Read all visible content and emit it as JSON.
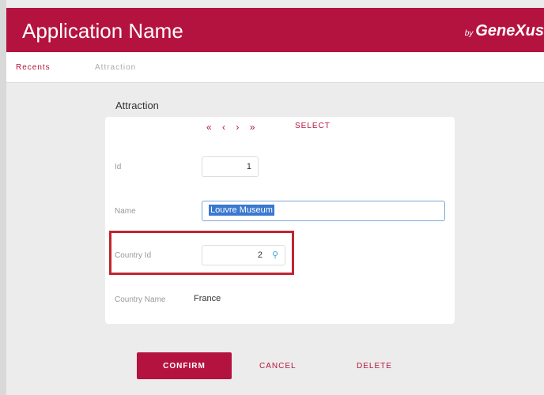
{
  "header": {
    "app_name": "Application Name",
    "brand_by": "by",
    "brand_name": "GeneXus"
  },
  "tabs": [
    {
      "label": "Recents"
    },
    {
      "label": "Attraction"
    }
  ],
  "form": {
    "title": "Attraction",
    "nav": {
      "first": "«",
      "prev": "‹",
      "next": "›",
      "last": "»",
      "select": "SELECT"
    },
    "fields": {
      "id": {
        "label": "Id",
        "value": "1"
      },
      "name": {
        "label": "Name",
        "value": "Louvre Museum"
      },
      "country_id": {
        "label": "Country Id",
        "value": "2",
        "prompt_icon": "lightbulb-icon"
      },
      "country_name": {
        "label": "Country Name",
        "value": "France"
      }
    }
  },
  "actions": {
    "confirm": "CONFIRM",
    "cancel": "CANCEL",
    "delete": "DELETE"
  },
  "colors": {
    "brand": "#b5133f",
    "highlight_box": "#c0262e"
  }
}
